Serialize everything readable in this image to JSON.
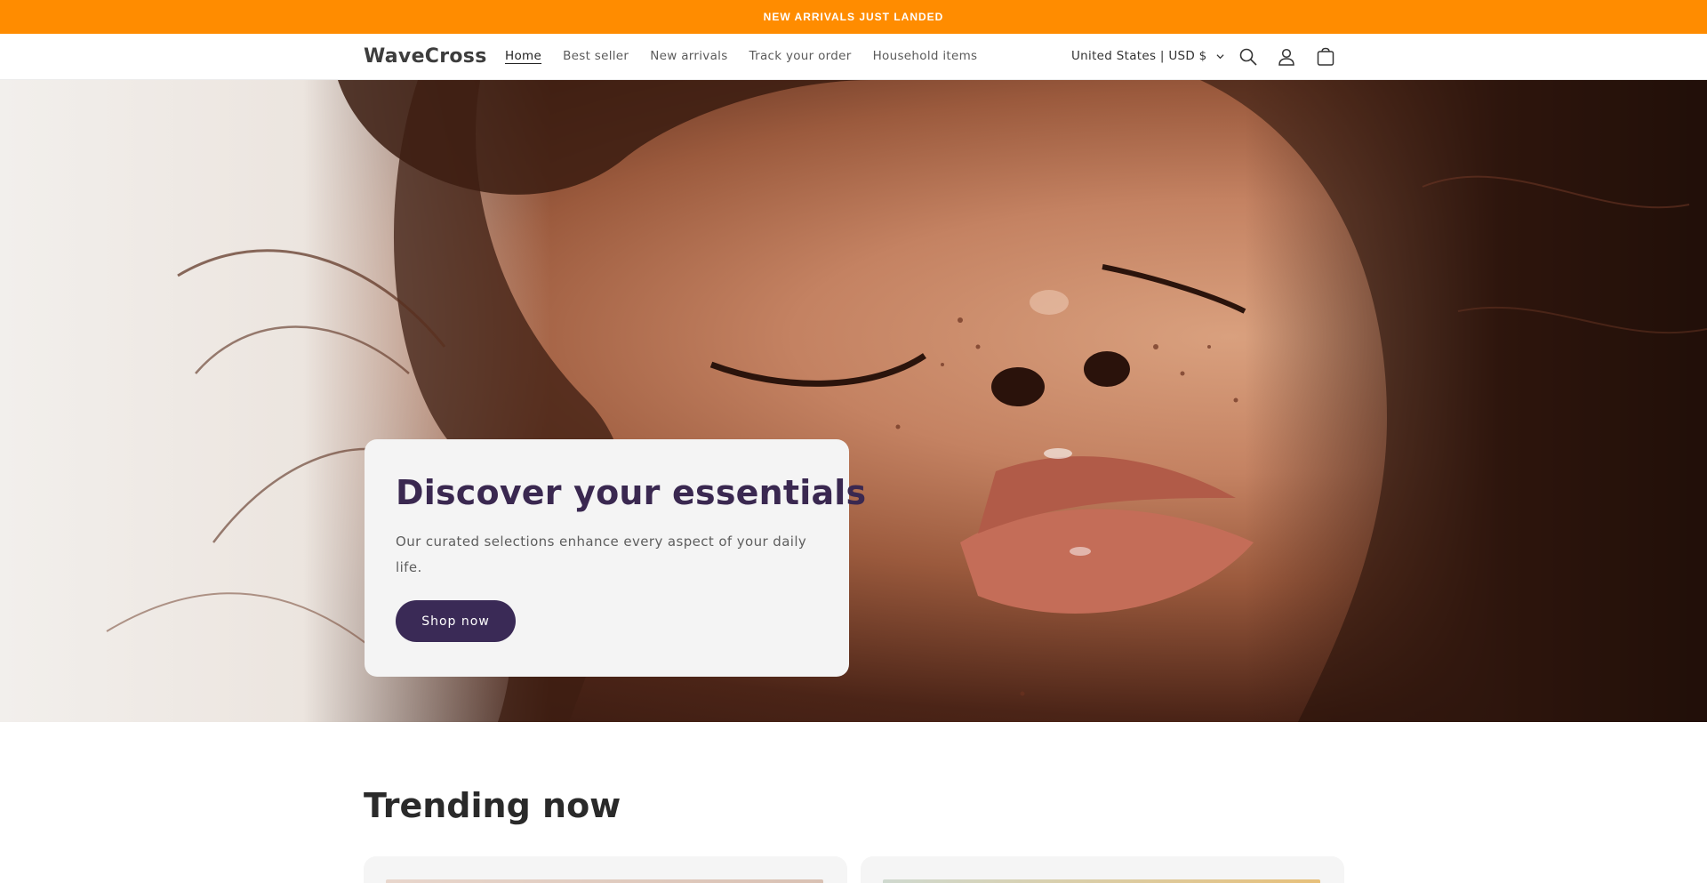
{
  "announcement": {
    "text": "NEW ARRIVALS JUST LANDED"
  },
  "header": {
    "logo": "WaveCross",
    "nav": [
      {
        "label": "Home",
        "active": true
      },
      {
        "label": "Best seller",
        "active": false
      },
      {
        "label": "New arrivals",
        "active": false
      },
      {
        "label": "Track your order",
        "active": false
      },
      {
        "label": "Household items",
        "active": false
      }
    ],
    "country_selector": "United States | USD $",
    "icons": [
      "search-icon",
      "account-icon",
      "cart-icon"
    ]
  },
  "hero": {
    "title": "Discover your essentials",
    "text": "Our curated selections enhance every aspect of your daily life.",
    "button_label": "Shop now"
  },
  "trending": {
    "title": "Trending now"
  },
  "colors": {
    "announcement_bg": "#ff8c00",
    "accent": "#3a2a56",
    "hero_card_bg": "#f4f4f4"
  }
}
